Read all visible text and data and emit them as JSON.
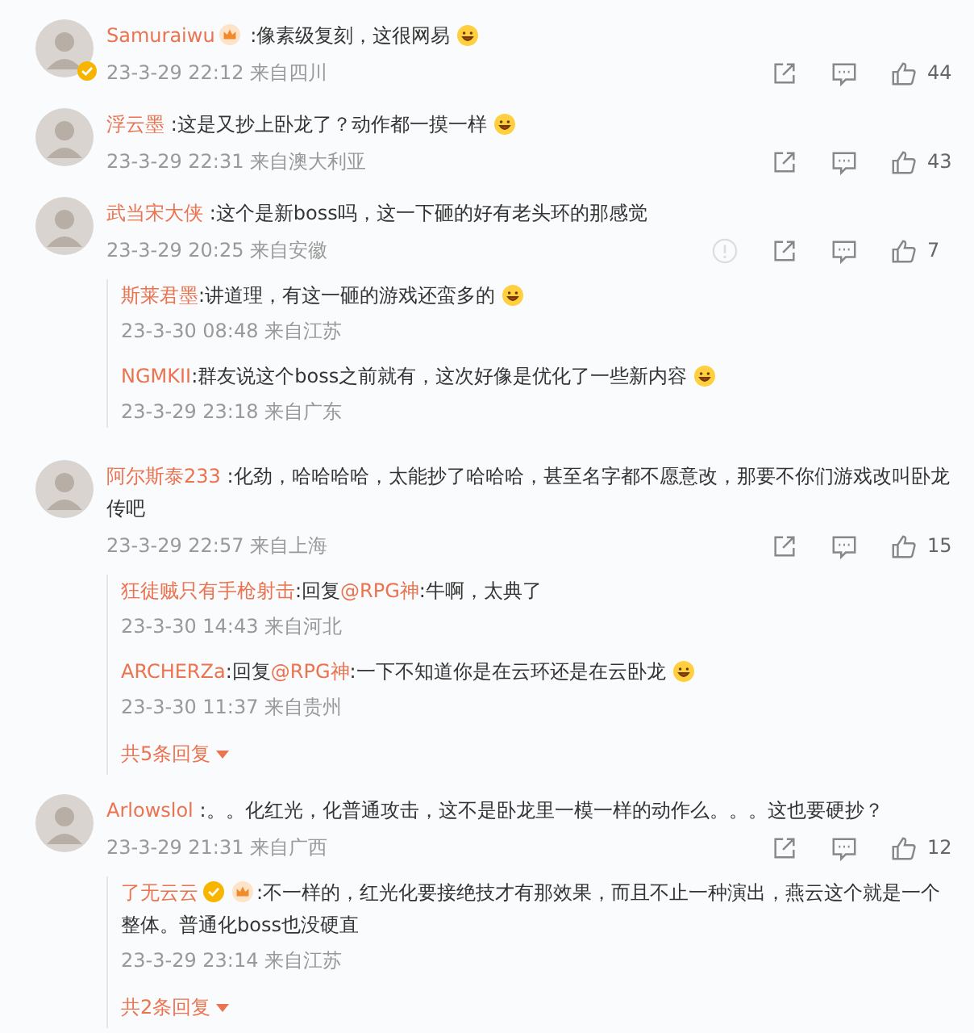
{
  "comments": [
    {
      "name": "Samuraiwu",
      "crown": true,
      "verified": false,
      "text": ":像素级复刻，这很网易",
      "emoji": true,
      "avatar_verified": true,
      "time": "23-3-29 22:12",
      "location": "来自四川",
      "info_icon": false,
      "likes": "44"
    },
    {
      "name": "浮云墨",
      "crown": false,
      "verified": false,
      "text": ":这是又抄上卧龙了？动作都一摸一样",
      "emoji": true,
      "avatar_verified": false,
      "time": "23-3-29 22:31",
      "location": "来自澳大利亚",
      "info_icon": false,
      "likes": "43"
    },
    {
      "name": "武当宋大侠",
      "crown": false,
      "verified": false,
      "text": ":这个是新boss吗，这一下砸的好有老头环的那感觉",
      "emoji": false,
      "avatar_verified": false,
      "time": "23-3-29 20:25",
      "location": "来自安徽",
      "info_icon": true,
      "likes": "7",
      "replies": [
        {
          "name": "斯莱君墨",
          "crown": false,
          "verified": false,
          "text": ":讲道理，有这一砸的游戏还蛮多的",
          "emoji": true,
          "time": "23-3-30 08:48",
          "location": "来自江苏"
        },
        {
          "name": "NGMKII",
          "crown": false,
          "verified": false,
          "text": ":群友说这个boss之前就有，这次好像是优化了一些新内容",
          "emoji": true,
          "time": "23-3-29 23:18",
          "location": "来自广东"
        }
      ]
    },
    {
      "name": "阿尔斯泰233",
      "crown": false,
      "verified": false,
      "text": ":化劲，哈哈哈哈，太能抄了哈哈哈，甚至名字都不愿意改，那要不你们游戏改叫卧龙传吧",
      "emoji": false,
      "avatar_verified": false,
      "time": "23-3-29 22:57",
      "location": "来自上海",
      "info_icon": false,
      "likes": "15",
      "replies": [
        {
          "name": "狂徒贼只有手枪射击",
          "crown": false,
          "verified": false,
          "reply_prefix": ":回复",
          "mention": "@RPG神",
          "text": ":牛啊，太典了",
          "emoji": false,
          "time": "23-3-30 14:43",
          "location": "来自河北"
        },
        {
          "name": "ARCHERZa",
          "crown": false,
          "verified": false,
          "reply_prefix": ":回复",
          "mention": "@RPG神",
          "text": ":一下不知道你是在云环还是在云卧龙",
          "emoji": true,
          "time": "23-3-30 11:37",
          "location": "来自贵州"
        }
      ],
      "more_replies": "共5条回复"
    },
    {
      "name": "Arlowslol",
      "crown": false,
      "verified": false,
      "text": ":。。化红光，化普通攻击，这不是卧龙里一模一样的动作么。。。这也要硬抄？",
      "emoji": false,
      "avatar_verified": false,
      "time": "23-3-29 21:31",
      "location": "来自广西",
      "info_icon": false,
      "likes": "12",
      "replies": [
        {
          "name": "了无云云",
          "crown": true,
          "verified": true,
          "text": ":不一样的，红光化要接绝技才有那效果，而且不止一种演出，燕云这个就是一个整体。普通化boss也没硬直",
          "emoji": false,
          "time": "23-3-29 23:14",
          "location": "来自江苏"
        }
      ],
      "more_replies": "共2条回复"
    }
  ]
}
